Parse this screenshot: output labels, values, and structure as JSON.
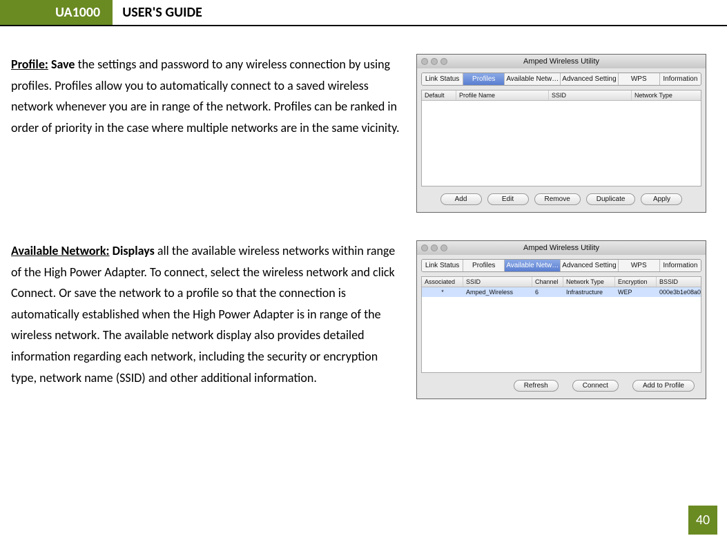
{
  "header": {
    "brand": "UA1000",
    "title": "USER'S GUIDE"
  },
  "profile": {
    "heading": "Profile:",
    "lead": "Save",
    "body": " the settings and password to any wireless connection by using profiles. Profiles allow you to automatically connect to a saved wireless network whenever you are in range of the network. Profiles can be ranked in order of priority in the case where multiple networks are in the same vicinity."
  },
  "available": {
    "heading": "Available Network:",
    "lead": "Displays",
    "body": " all the available wireless networks within range of the High Power Adapter. To connect, select the wireless network and click Connect. Or save the network to a profile so that the connection is automatically established when the High Power Adapter is in range of the wireless network. The available network display also provides detailed information regarding each network, including the security or encryption type, network name (SSID) and other additional information."
  },
  "win": {
    "title": "Amped Wireless Utility"
  },
  "tabs": {
    "link_status": "Link Status",
    "profiles": "Profiles",
    "available": "Available Netw…",
    "advanced": "Advanced Setting",
    "wps": "WPS",
    "info": "Information"
  },
  "profiles_panel": {
    "cols": {
      "default": "Default",
      "name": "Profile Name",
      "ssid": "SSID",
      "type": "Network Type"
    },
    "buttons": {
      "add": "Add",
      "edit": "Edit",
      "remove": "Remove",
      "duplicate": "Duplicate",
      "apply": "Apply"
    }
  },
  "avail_panel": {
    "cols": {
      "assoc": "Associated",
      "ssid": "SSID",
      "channel": "Channel",
      "type": "Network Type",
      "enc": "Encryption",
      "bssid": "BSSID"
    },
    "row": {
      "assoc": "*",
      "ssid": "Amped_Wireless",
      "channel": "6",
      "type": "Infrastructure",
      "enc": "WEP",
      "bssid": "000e3b1e08a0"
    },
    "buttons": {
      "refresh": "Refresh",
      "connect": "Connect",
      "add": "Add to Profile"
    }
  },
  "page_number": "40"
}
